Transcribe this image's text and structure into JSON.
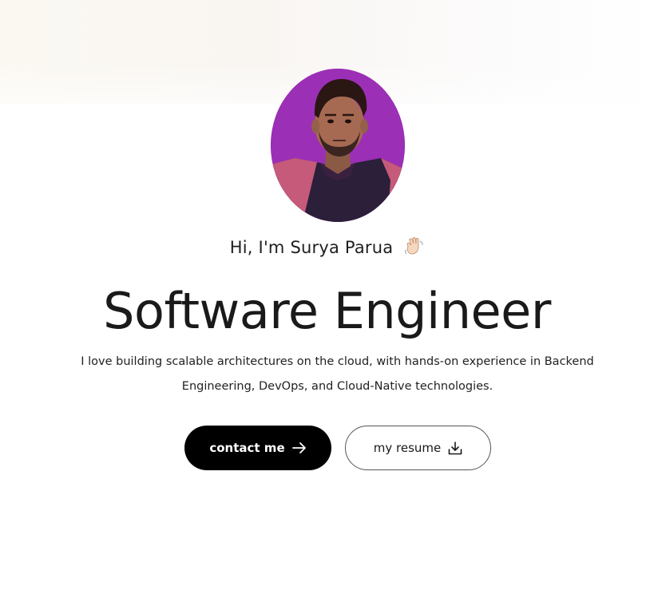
{
  "hero": {
    "greeting": "Hi, I'm Surya Parua",
    "greeting_emoji": "waving-hand-icon",
    "headline": "Software Engineer",
    "description": "I love building scalable architectures on the cloud, with hands-on experience in Backend Engineering, DevOps, and Cloud-Native technologies.",
    "avatar_background": "#9b2fb5"
  },
  "actions": {
    "contact_label": "contact me",
    "contact_icon": "arrow-right-icon",
    "resume_label": "my resume",
    "resume_icon": "download-icon"
  }
}
